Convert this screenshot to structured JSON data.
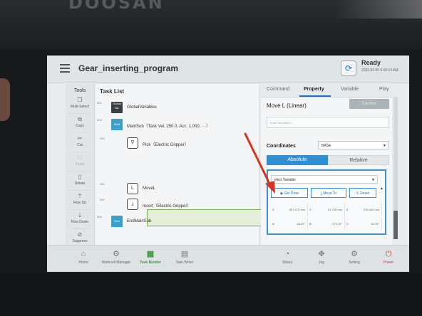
{
  "device": {
    "brand": "DOOSAN"
  },
  "header": {
    "program_title": "Gear_inserting_program",
    "status": "Ready",
    "status_time": "2020.03.05 6:15:13 AM"
  },
  "tools": {
    "title": "Tools",
    "items": [
      {
        "label": "Multi-Select",
        "icon": "multi-select-icon",
        "glyph": "❐"
      },
      {
        "label": "Copy",
        "icon": "copy-icon",
        "glyph": "⧉"
      },
      {
        "label": "Cut",
        "icon": "cut-icon",
        "glyph": "✂"
      },
      {
        "label": "Paste",
        "icon": "paste-icon",
        "glyph": "📋"
      },
      {
        "label": "Delete",
        "icon": "delete-icon",
        "glyph": "🗑"
      },
      {
        "label": "Row Up",
        "icon": "row-up-icon",
        "glyph": "⇡"
      },
      {
        "label": "Row Down",
        "icon": "row-down-icon",
        "glyph": "⇣"
      },
      {
        "label": "Suppress",
        "icon": "suppress-icon",
        "glyph": "⊘"
      }
    ]
  },
  "task_list": {
    "title": "Task List",
    "rows": [
      {
        "num": "001",
        "tag": "Global Var.",
        "label": "GlobalVariables"
      },
      {
        "num": "002",
        "tag": "Start",
        "label": "MainSub（Task Vel. 250.0, Acc. 1,000, ···）"
      },
      {
        "num": "003",
        "icon": "gripper-icon",
        "label": "Pick（Electric Gripper）"
      },
      {
        "num": "004",
        "icon": "move-l-icon",
        "label": "MoveL"
      },
      {
        "num": "005",
        "icon": "insert-icon",
        "label": "Insert（Electric Gripper）"
      },
      {
        "num": "006",
        "tag": "End",
        "label": "EndMainSub"
      }
    ]
  },
  "panel": {
    "tabs": [
      "Command",
      "Property",
      "Variable",
      "Play"
    ],
    "active_tab": "Property",
    "title": "Move L (Linear)",
    "confirm_label": "Confirm",
    "annotation_placeholder": "Enter Annotation",
    "coordinates_label": "Coordinates",
    "coordinates_value": "BASE",
    "mode_absolute": "Absolute",
    "mode_relative": "Relative",
    "variable_select": "elect Variable",
    "buttons": {
      "get_pose": "Get Pose",
      "move_to": "Move To",
      "reset": "Reset"
    },
    "pose": [
      {
        "axis": "X",
        "value": "597.470 mm"
      },
      {
        "axis": "Y",
        "value": "21.720 mm"
      },
      {
        "axis": "Z",
        "value": "278.400 mm"
      },
      {
        "axis": "A",
        "value": "48.29°"
      },
      {
        "axis": "B",
        "value": "-179.10°"
      },
      {
        "axis": "C",
        "value": "30.78°"
      }
    ]
  },
  "bottom_nav": [
    {
      "label": "Home",
      "icon": "home-icon",
      "glyph": "⌂"
    },
    {
      "label": "Workcell Manager",
      "icon": "workcell-manager-icon",
      "glyph": "⚙"
    },
    {
      "label": "Task Builder",
      "icon": "task-builder-icon",
      "glyph": "▦",
      "active": true
    },
    {
      "label": "Task Writer",
      "icon": "task-writer-icon",
      "glyph": "▤"
    },
    {
      "label": "Status",
      "icon": "status-icon",
      "glyph": "◔"
    },
    {
      "label": "Jog",
      "icon": "jog-icon",
      "glyph": "✥"
    },
    {
      "label": "Setting",
      "icon": "setting-icon",
      "glyph": "⚙"
    },
    {
      "label": "Power",
      "icon": "power-icon",
      "glyph": "⏻"
    }
  ],
  "colors": {
    "accent": "#2f8fd0",
    "selected_row": "#e3efd9",
    "selected_border": "#7ab352",
    "annotation_arrow": "#d6361b",
    "task_builder_active": "#3d9a3f"
  }
}
